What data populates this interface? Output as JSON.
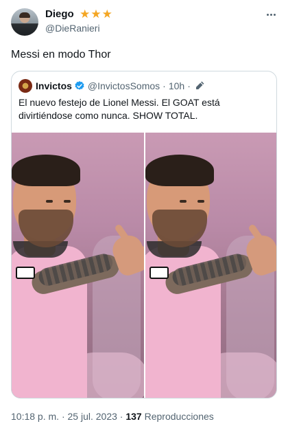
{
  "tweet": {
    "author": {
      "display_name": "Diego",
      "handle": "@DieRanieri",
      "badge_stars": "★★★",
      "avatar_icon": "user-avatar"
    },
    "text": "Messi en modo Thor",
    "more_icon": "more-horizontal-icon",
    "quoted": {
      "display_name": "Invictos",
      "handle": "@InvictosSomos",
      "separator": "·",
      "time": "10h",
      "separator2": "·",
      "verified_icon": "verified-badge-icon",
      "edited_icon": "edit-pencil-icon",
      "text": "El nuevo festejo de Lionel Messi. El GOAT está divirtiéndose como nunca. SHOW TOTAL.",
      "media": [
        {
          "name": "media-image-left"
        },
        {
          "name": "media-image-right"
        }
      ]
    },
    "meta": {
      "time": "10:18 p. m.",
      "dot1": "·",
      "date": "25 jul. 2023",
      "dot2": "·",
      "views_count": "137",
      "views_label": "Reproducciones"
    },
    "colors": {
      "accent_verified": "#1d9bf0",
      "star": "#f4a623",
      "secondary_text": "#536471",
      "border": "#cfd9de"
    }
  }
}
